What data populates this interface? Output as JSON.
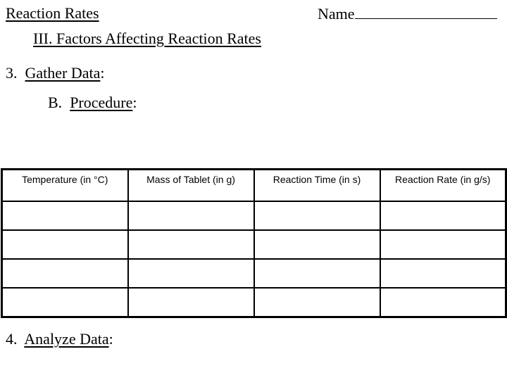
{
  "header": {
    "title": "Reaction Rates",
    "name_label": "Name"
  },
  "section": {
    "heading": "III.  Factors Affecting Reaction Rates"
  },
  "steps": {
    "gather_number": "3.",
    "gather_label": "Gather Data",
    "procedure_letter": "B.",
    "procedure_label": "Procedure",
    "analyze_number": "4.",
    "analyze_label": "Analyze Data",
    "colon": ":"
  },
  "table": {
    "columns": [
      "Temperature (in °C)",
      "Mass of Tablet (in g)",
      "Reaction Time (in s)",
      "Reaction Rate (in g/s)"
    ],
    "rows": [
      [
        "",
        "",
        "",
        ""
      ],
      [
        "",
        "",
        "",
        ""
      ],
      [
        "",
        "",
        "",
        ""
      ],
      [
        "",
        "",
        "",
        ""
      ]
    ]
  }
}
